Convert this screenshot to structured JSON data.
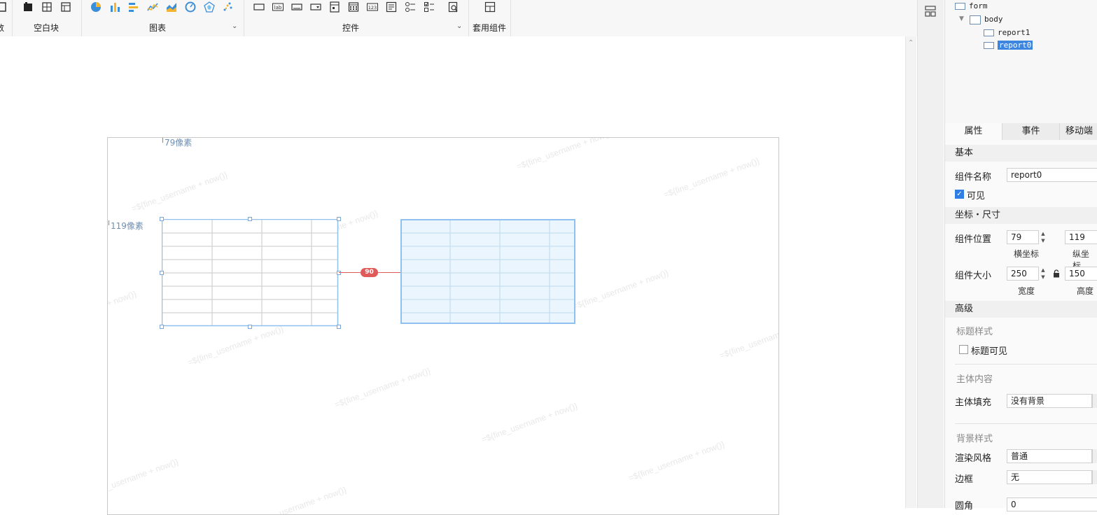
{
  "toolbar": {
    "groups": [
      {
        "label": "数"
      },
      {
        "label": "空白块"
      },
      {
        "label": "图表"
      },
      {
        "label": "控件"
      },
      {
        "label": "套用组件"
      }
    ],
    "widget_icons": {
      "label_icon_text": "lab",
      "number_icon_text": "123"
    }
  },
  "canvas": {
    "ruler_x": "79像素",
    "ruler_y": "119像素",
    "distance_badge": "90",
    "watermark_text": "=${fine_username + now()}"
  },
  "tree": {
    "root": "form",
    "body": "body",
    "children": [
      "report1",
      "report0"
    ],
    "selected": "report0"
  },
  "props": {
    "tabs": [
      "属性",
      "事件",
      "移动端"
    ],
    "basic": {
      "title": "基本",
      "name_label": "组件名称",
      "name_value": "report0",
      "visible_label": "可见"
    },
    "position": {
      "title": "坐标・尺寸",
      "pos_label": "组件位置",
      "x_value": "79",
      "y_value": "119",
      "x_caption": "横坐标",
      "y_caption": "纵坐标",
      "size_label": "组件大小",
      "width_value": "250",
      "height_value": "150",
      "width_caption": "宽度",
      "height_caption": "高度"
    },
    "advanced": {
      "title": "高级",
      "title_style": "标题样式",
      "title_visible": "标题可见",
      "body_content": "主体内容",
      "body_fill_label": "主体填充",
      "body_fill_value": "没有背景",
      "bg_style": "背景样式",
      "render_label": "渲染风格",
      "render_value": "普通",
      "border_label": "边框",
      "border_value": "无",
      "corner_label": "圆角",
      "corner_value": "0"
    }
  },
  "colors": {
    "accent": "#3d86e0",
    "badge": "#e05a5a",
    "selection_border": "#8fc0ee",
    "report_fill": "#eaf5fd"
  }
}
